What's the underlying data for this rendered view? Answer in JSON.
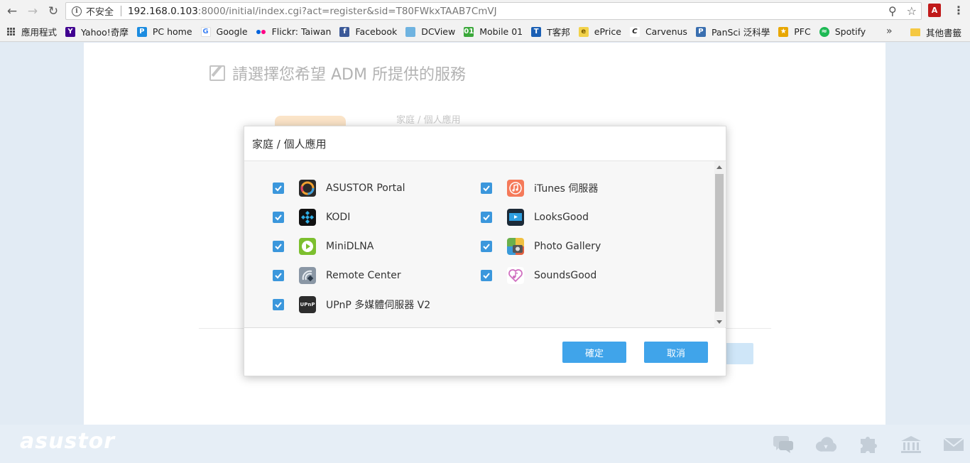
{
  "browser": {
    "security_label": "不安全",
    "url_main": "192.168.0.103",
    "url_rest": ":8000/initial/index.cgi?act=register&sid=T80FWkxTAAB7CmVJ",
    "bookmarks": [
      {
        "label": "應用程式",
        "icon": "apps-grid-icon"
      },
      {
        "label": "Yahoo!奇摩",
        "icon": "yahoo-icon",
        "color": "#400090"
      },
      {
        "label": "PC home",
        "icon": "pchome-icon",
        "color": "#1c8ce0"
      },
      {
        "label": "Google",
        "icon": "google-icon",
        "color": "#4285f4"
      },
      {
        "label": "Flickr: Taiwan",
        "icon": "flickr-icon",
        "color": "#ff0084"
      },
      {
        "label": "Facebook",
        "icon": "facebook-icon",
        "color": "#3b5998"
      },
      {
        "label": "DCView",
        "icon": "dcview-icon",
        "color": "#6fb3e0"
      },
      {
        "label": "Mobile 01",
        "icon": "mobile01-icon",
        "color": "#3aa83a"
      },
      {
        "label": "T客邦",
        "icon": "tkbang-icon",
        "color": "#1a5fb4"
      },
      {
        "label": "ePrice",
        "icon": "eprice-icon",
        "color": "#d9a400"
      },
      {
        "label": "Carvenus",
        "icon": "carvenus-icon",
        "color": "#222222"
      },
      {
        "label": "PanSci 泛科學",
        "icon": "pansci-icon",
        "color": "#3a6fb0"
      },
      {
        "label": "PFC",
        "icon": "pfc-icon",
        "color": "#e8a700"
      },
      {
        "label": "Spotify",
        "icon": "spotify-icon",
        "color": "#1db954"
      }
    ],
    "more_label": "»",
    "other_bookmarks": "其他書籤"
  },
  "wizard": {
    "title": "請選擇您希望 ADM 所提供的服務",
    "background_subtitle": "家庭 / 個人應用"
  },
  "dialog": {
    "title": "家庭 / 個人應用",
    "apps_left": [
      {
        "name": "ASUSTOR Portal",
        "icon": "asustor-portal-icon",
        "checked": true
      },
      {
        "name": "KODI",
        "icon": "kodi-icon",
        "checked": true
      },
      {
        "name": "MiniDLNA",
        "icon": "minidlna-icon",
        "checked": true
      },
      {
        "name": "Remote Center",
        "icon": "remote-center-icon",
        "checked": true
      },
      {
        "name": "UPnP 多媒體伺服器 V2",
        "icon": "upnp-icon",
        "checked": true
      }
    ],
    "apps_right": [
      {
        "name": "iTunes 伺服器",
        "icon": "itunes-icon",
        "checked": true
      },
      {
        "name": "LooksGood",
        "icon": "looksgood-icon",
        "checked": true
      },
      {
        "name": "Photo Gallery",
        "icon": "photo-gallery-icon",
        "checked": true
      },
      {
        "name": "SoundsGood",
        "icon": "soundsgood-icon",
        "checked": true
      }
    ],
    "confirm_label": "確定",
    "cancel_label": "取消"
  },
  "footer": {
    "logo": "asustor",
    "icons": [
      "chat-icon",
      "cloud-download-icon",
      "puzzle-icon",
      "bank-icon",
      "mail-icon"
    ]
  },
  "colors": {
    "accent": "#40a4ea",
    "checkbox": "#3b97dc"
  }
}
